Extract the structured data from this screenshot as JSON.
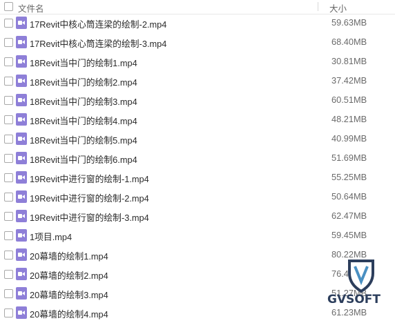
{
  "header": {
    "name_label": "文件名",
    "size_label": "大小"
  },
  "files": [
    {
      "name": "17Revit中核心筒连梁的绘制-2.mp4",
      "size": "59.63MB"
    },
    {
      "name": "17Revit中核心筒连梁的绘制-3.mp4",
      "size": "68.40MB"
    },
    {
      "name": "18Revit当中门的绘制1.mp4",
      "size": "30.81MB"
    },
    {
      "name": "18Revit当中门的绘制2.mp4",
      "size": "37.42MB"
    },
    {
      "name": "18Revit当中门的绘制3.mp4",
      "size": "60.51MB"
    },
    {
      "name": "18Revit当中门的绘制4.mp4",
      "size": "48.21MB"
    },
    {
      "name": "18Revit当中门的绘制5.mp4",
      "size": "40.99MB"
    },
    {
      "name": "18Revit当中门的绘制6.mp4",
      "size": "51.69MB"
    },
    {
      "name": "19Revit中进行窗的绘制-1.mp4",
      "size": "55.25MB"
    },
    {
      "name": "19Revit中进行窗的绘制-2.mp4",
      "size": "50.64MB"
    },
    {
      "name": "19Revit中进行窗的绘制-3.mp4",
      "size": "62.47MB"
    },
    {
      "name": "1项目.mp4",
      "size": "59.45MB"
    },
    {
      "name": "20幕墙的绘制1.mp4",
      "size": "80.22MB"
    },
    {
      "name": "20幕墙的绘制2.mp4",
      "size": "76.4"
    },
    {
      "name": "20幕墙的绘制3.mp4",
      "size": "51.27MB"
    },
    {
      "name": "20幕墙的绘制4.mp4",
      "size": "61.23MB"
    }
  ],
  "watermark": {
    "text": "GVSOFT"
  },
  "colors": {
    "video_icon": "#8e7fd8",
    "watermark": "#2c3e5c"
  },
  "icons": {
    "file_icon": "video-file-icon"
  }
}
